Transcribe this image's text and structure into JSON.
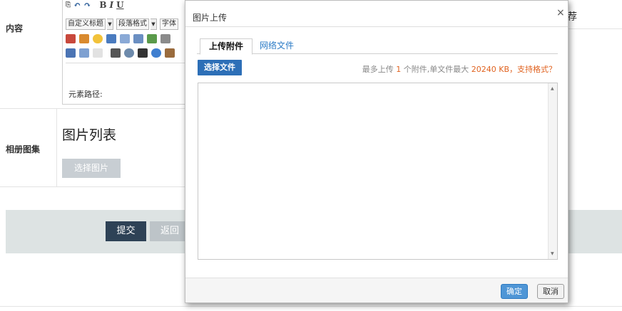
{
  "form": {
    "content_label": "内容",
    "album_label": "相册图集",
    "album_title": "图片列表",
    "select_image_button": "选择图片",
    "submit_button": "提交",
    "back_button": "返回",
    "right_partial_text": "荐"
  },
  "editor": {
    "toolbar_glyphs": [
      "B",
      "I",
      "U"
    ],
    "custom_title_select": "自定义标题",
    "paragraph_select": "段落格式",
    "font_select": "字体",
    "element_path_label": "元素路径:"
  },
  "dialog": {
    "title": "图片上传",
    "close_glyph": "×",
    "tabs": [
      {
        "label": "上传附件",
        "active": true
      },
      {
        "label": "网络文件",
        "active": false
      }
    ],
    "choose_file_button": "选择文件",
    "upload_info": {
      "prefix": "最多上传",
      "max_count": "1",
      "middle": "个附件,单文件最大",
      "max_size": "20240 KB",
      "suffix": "，支持格式？"
    },
    "ok_button": "确定",
    "cancel_button": "取消"
  },
  "icons": [
    "undo-icon",
    "redo-icon",
    "image-icon",
    "emoticon-icon",
    "music-icon",
    "attachment-icon",
    "table-icon",
    "print-icon",
    "preview-icon",
    "search-icon",
    "help-icon"
  ],
  "colors": {
    "primary_blue": "#2d6fb7",
    "dark_button": "#2e4256",
    "highlight_orange": "#e0621f",
    "link_blue": "#2b7bc6"
  }
}
